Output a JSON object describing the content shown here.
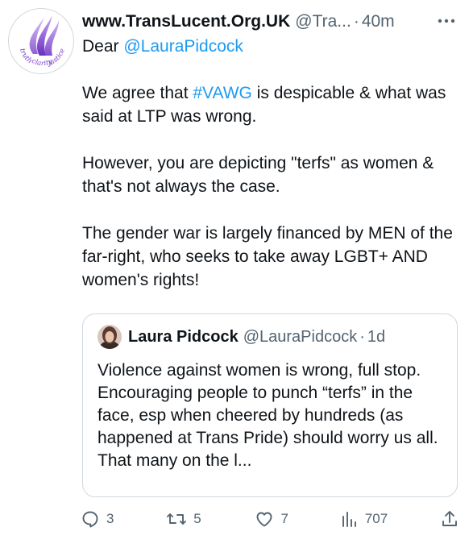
{
  "tweet": {
    "display_name": "www.TransLucent.Org.UK",
    "handle": "@Tra...",
    "separator": "·",
    "time": "40m",
    "body": {
      "line1_prefix": "Dear ",
      "line1_mention": "@LauraPidcock",
      "p1_a": "We agree that ",
      "p1_hashtag": "#VAWG",
      "p1_b": " is despicable & what was said at LTP was wrong.",
      "p2": "However, you are depicting \"terfs\" as women & that's not always the case.",
      "p3": "The gender war is largely financed by MEN of the far-right, who seeks to take away LGBT+ AND women's rights!"
    },
    "avatar_logo_words": [
      "truth",
      "clarity",
      "justice"
    ]
  },
  "quote": {
    "display_name": "Laura Pidcock",
    "handle": "@LauraPidcock",
    "separator": "·",
    "time": "1d",
    "text": "Violence against women is wrong, full stop. Encouraging people to punch “terfs” in the face, esp when cheered by hundreds (as happened at Trans Pride) should worry us all. That many on the l..."
  },
  "actions": {
    "replies": "3",
    "retweets": "5",
    "likes": "7",
    "views": "707"
  },
  "colors": {
    "text": "#0f1419",
    "secondary": "#536471",
    "link": "#1d9bf0",
    "border": "#cfd9de",
    "logo_purple": "#8a4fd6"
  },
  "icons": [
    "more-icon",
    "reply-icon",
    "retweet-icon",
    "like-icon",
    "views-icon",
    "share-icon"
  ]
}
